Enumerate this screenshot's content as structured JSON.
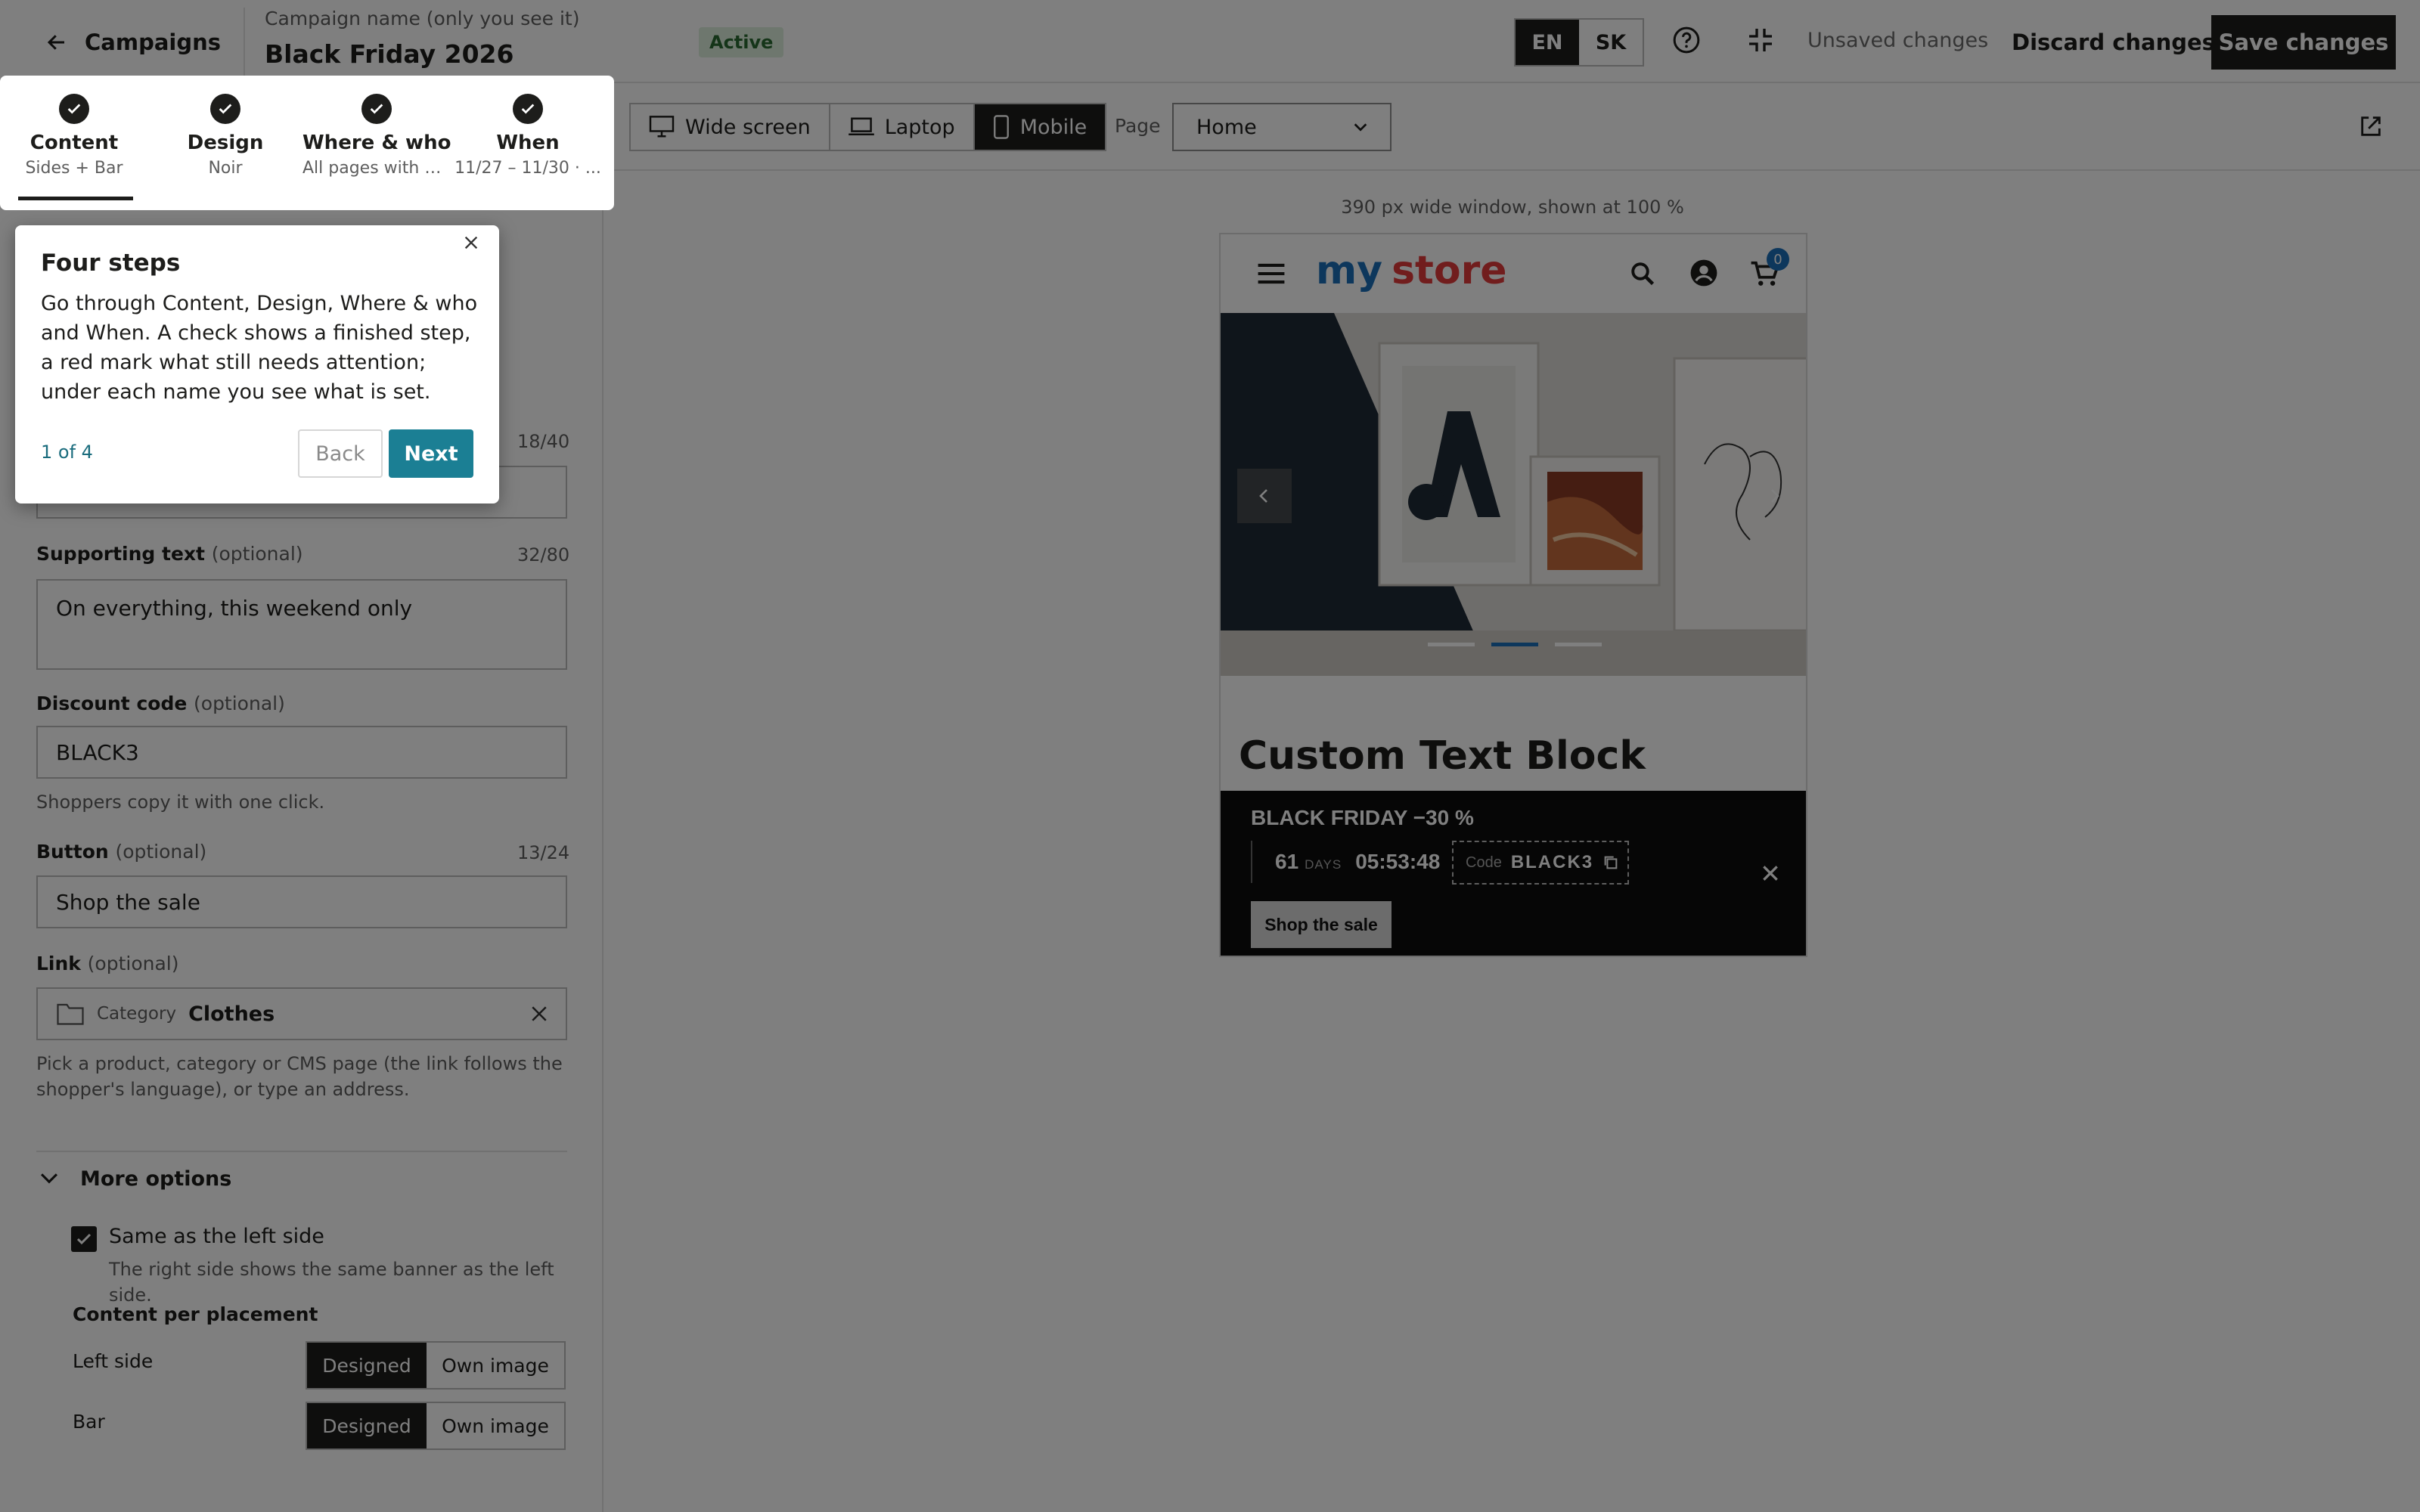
{
  "topbar": {
    "back_label": "Campaigns",
    "name_label": "Campaign name (only you see it)",
    "name_value": "Black Friday 2026",
    "status": "Active",
    "languages": [
      "EN",
      "SK"
    ],
    "active_language": "EN",
    "unsaved": "Unsaved changes",
    "discard": "Discard changes",
    "save": "Save changes"
  },
  "steps": [
    {
      "name": "Content",
      "sub": "Sides + Bar"
    },
    {
      "name": "Design",
      "sub": "Noir"
    },
    {
      "name": "Where & who",
      "sub": "All pages with ex..."
    },
    {
      "name": "When",
      "sub": "11/27 – 11/30 · ..."
    }
  ],
  "form": {
    "headline_count": "18/40",
    "supporting": {
      "label": "Supporting text",
      "optional": "(optional)",
      "count": "32/80",
      "value": "On everything, this weekend only"
    },
    "discount": {
      "label": "Discount code",
      "optional": "(optional)",
      "value": "BLACK3",
      "help": "Shoppers copy it with one click."
    },
    "button": {
      "label": "Button",
      "optional": "(optional)",
      "count": "13/24",
      "value": "Shop the sale"
    },
    "link": {
      "label": "Link",
      "optional": "(optional)",
      "type": "Category",
      "value": "Clothes",
      "help": "Pick a product, category or CMS page (the link follows the shopper's language), or type an address."
    },
    "more_options": "More options",
    "same_as_left": {
      "label": "Same as the left side",
      "help": "The right side shows the same banner as the left side.",
      "checked": true
    },
    "content_per_placement": "Content per placement",
    "placements": [
      {
        "name": "Left side",
        "options": [
          "Designed",
          "Own image"
        ],
        "selected": "Designed"
      },
      {
        "name": "Bar",
        "options": [
          "Designed",
          "Own image"
        ],
        "selected": "Designed"
      }
    ]
  },
  "preview": {
    "devices": [
      "Wide screen",
      "Laptop",
      "Mobile"
    ],
    "active_device": "Mobile",
    "page_label": "Page",
    "page_value": "Home",
    "window_note": "390 px wide window, shown at 100 %"
  },
  "store": {
    "logo_part1": "my",
    "logo_part2": "store",
    "cart_count": "0",
    "block_title": "Custom Text Block",
    "promo_title": "BLACK FRIDAY −30  %",
    "days_num": "61",
    "days_label": "DAYS",
    "time": "05:53:48",
    "code_label": "Code",
    "code_value": "BLACK3",
    "cta": "Shop the sale"
  },
  "coach": {
    "title": "Four steps",
    "body": "Go through Content, Design, Where & who and When. A check shows a finished step, a red mark what still needs attention; under each name you see what is set.",
    "counter": "1 of 4",
    "back": "Back",
    "next": "Next"
  },
  "colors": {
    "accent": "#1b7f94",
    "dark": "#1d1d1b",
    "status_bg": "#dcefdc",
    "promo_bg": "#0d0d0d"
  }
}
